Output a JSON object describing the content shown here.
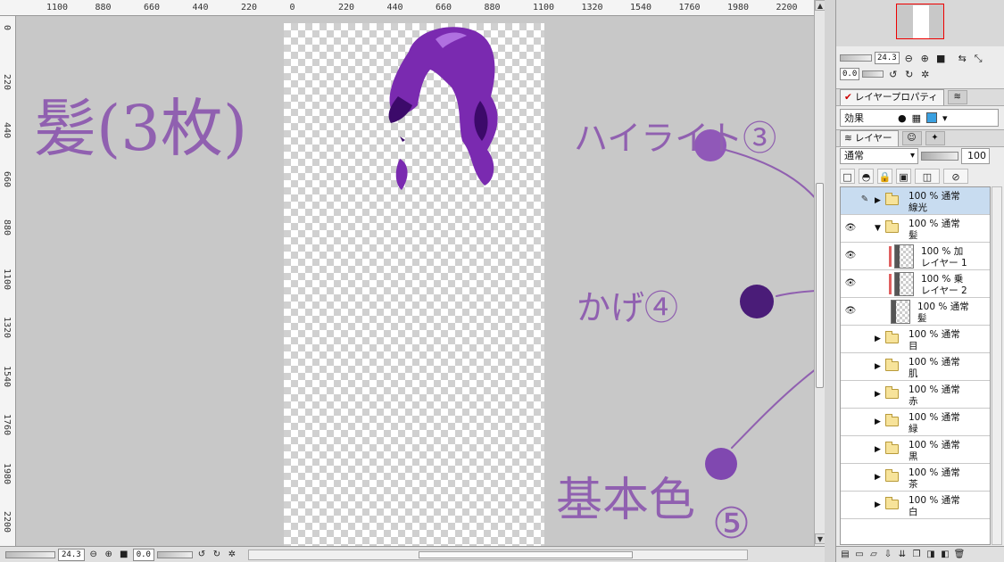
{
  "ruler": {
    "top_labels": [
      "1100",
      "880",
      "660",
      "440",
      "220",
      "0",
      "220",
      "440",
      "660",
      "880",
      "1100",
      "1320",
      "1540",
      "1760",
      "1980",
      "2200"
    ],
    "left_labels": [
      "0",
      "220",
      "440",
      "660",
      "880",
      "1100",
      "1320",
      "1540",
      "1760",
      "1980",
      "2200"
    ]
  },
  "annotations": {
    "title": "髪(3枚)",
    "highlight": "ハイライト③",
    "shadow": "かげ④",
    "base": "基本色",
    "base_number": "⑤",
    "ink_color": "#9060b0"
  },
  "hair_colors": {
    "main": "#7a2ab0",
    "dark": "#3c0a6a",
    "light": "#b070e0"
  },
  "navigator": {
    "zoom": "24.3",
    "rotation": "0.0"
  },
  "bottom_bar": {
    "zoom": "24.3",
    "rotation": "0.0"
  },
  "tabs": {
    "layer_property": "レイヤープロパティ",
    "layer": "レイヤー"
  },
  "property": {
    "effect_label": "効果",
    "color": "#3aa0e0"
  },
  "blend": {
    "mode": "通常",
    "opacity": "100"
  },
  "layers": [
    {
      "name": "線光",
      "mode": "100 % 通常",
      "type": "folder",
      "collapsed": true,
      "selected": true,
      "eye": false,
      "pen": true,
      "indent": 0
    },
    {
      "name": "髪",
      "mode": "100 % 通常",
      "type": "folder",
      "collapsed": false,
      "selected": false,
      "eye": true,
      "pen": false,
      "indent": 0
    },
    {
      "name": "レイヤー 1",
      "mode": "100 % 加",
      "type": "raster",
      "selected": false,
      "eye": true,
      "clip": true,
      "indent": 1
    },
    {
      "name": "レイヤー 2",
      "mode": "100 % 乗",
      "type": "raster",
      "selected": false,
      "eye": true,
      "clip": true,
      "indent": 1
    },
    {
      "name": "髪",
      "mode": "100 % 通常",
      "type": "raster",
      "selected": false,
      "eye": true,
      "clip": false,
      "indent": 1
    },
    {
      "name": "目",
      "mode": "100 % 通常",
      "type": "folder",
      "collapsed": true,
      "selected": false,
      "eye": false,
      "indent": 0
    },
    {
      "name": "肌",
      "mode": "100 % 通常",
      "type": "folder",
      "collapsed": true,
      "selected": false,
      "eye": false,
      "indent": 0
    },
    {
      "name": "赤",
      "mode": "100 % 通常",
      "type": "folder",
      "collapsed": true,
      "selected": false,
      "eye": false,
      "indent": 0
    },
    {
      "name": "緑",
      "mode": "100 % 通常",
      "type": "folder",
      "collapsed": true,
      "selected": false,
      "eye": false,
      "indent": 0
    },
    {
      "name": "黒",
      "mode": "100 % 通常",
      "type": "folder",
      "collapsed": true,
      "selected": false,
      "eye": false,
      "indent": 0
    },
    {
      "name": "茶",
      "mode": "100 % 通常",
      "type": "folder",
      "collapsed": true,
      "selected": false,
      "eye": false,
      "indent": 0
    },
    {
      "name": "白",
      "mode": "100 % 通常",
      "type": "folder",
      "collapsed": true,
      "selected": false,
      "eye": false,
      "indent": 0
    }
  ]
}
